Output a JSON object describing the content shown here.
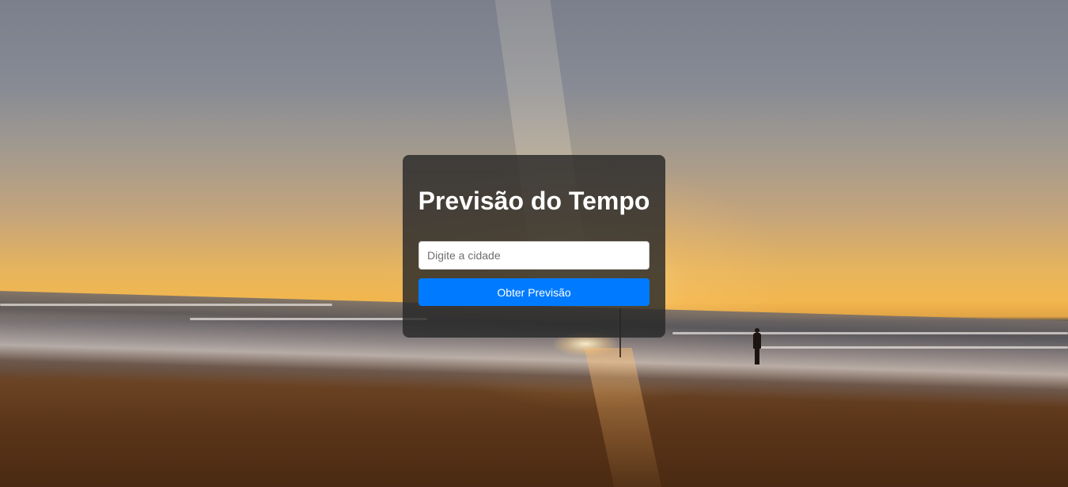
{
  "app": {
    "title": "Previsão do Tempo"
  },
  "search": {
    "placeholder": "Digite a cidade",
    "value": ""
  },
  "actions": {
    "submit_label": "Obter Previsão"
  },
  "colors": {
    "card_background": "#282828",
    "button_primary": "#007bff",
    "title_text": "#ffffff"
  },
  "background": {
    "image": "beach-sunset-photo"
  }
}
